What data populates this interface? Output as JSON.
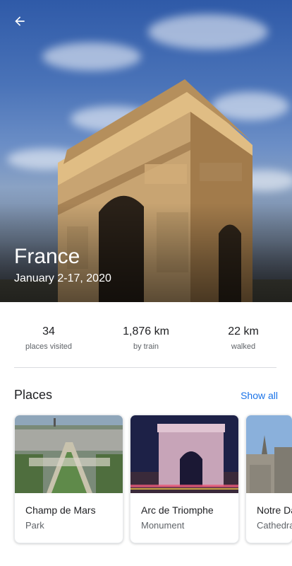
{
  "hero": {
    "title": "France",
    "dates": "January 2-17, 2020"
  },
  "stats": [
    {
      "value": "34",
      "label": "places visited"
    },
    {
      "value": "1,876 km",
      "label": "by train"
    },
    {
      "value": "22 km",
      "label": "walked"
    }
  ],
  "places": {
    "title": "Places",
    "show_all": "Show all",
    "items": [
      {
        "name": "Champ de Mars",
        "type": "Park"
      },
      {
        "name": "Arc de Triomphe",
        "type": "Monument"
      },
      {
        "name": "Notre Dame",
        "type": "Cathedral"
      }
    ]
  },
  "colors": {
    "accent": "#1a73e8",
    "text_primary": "#202124",
    "text_secondary": "#5f6368"
  },
  "icons": {
    "back": "arrow-back-icon"
  }
}
